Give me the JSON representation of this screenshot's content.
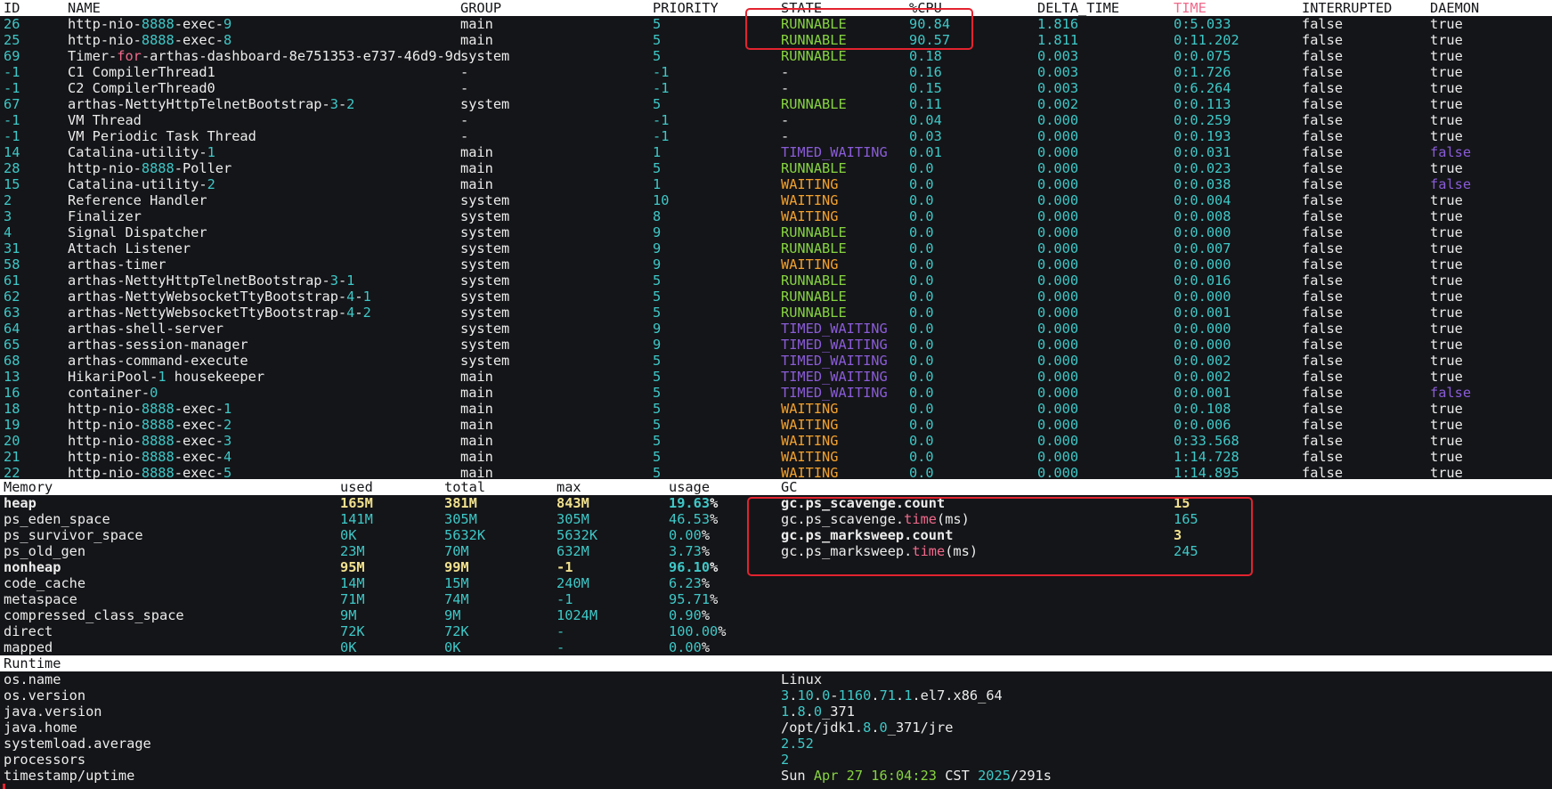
{
  "thread_table": {
    "headers": {
      "id": "ID",
      "name": "NAME",
      "group": "GROUP",
      "priority": "PRIORITY",
      "state": "STATE",
      "cpu": "%CPU",
      "delta": "DELTA_TIME",
      "time": "TIME",
      "interrupted": "INTERRUPTED",
      "daemon": "DAEMON"
    },
    "rows": [
      {
        "id": "26",
        "name": [
          "http-nio-",
          [
            "8888",
            "cyan"
          ],
          "-exec-",
          [
            "9",
            "cyan"
          ]
        ],
        "group": "main",
        "priority": "5",
        "state": "RUNNABLE",
        "cpu": "90.84",
        "delta": "1.816",
        "time": "0:5.033",
        "interrupted": "false",
        "daemon": "true"
      },
      {
        "id": "25",
        "name": [
          "http-nio-",
          [
            "8888",
            "cyan"
          ],
          "-exec-",
          [
            "8",
            "cyan"
          ]
        ],
        "group": "main",
        "priority": "5",
        "state": "RUNNABLE",
        "cpu": "90.57",
        "delta": "1.811",
        "time": "0:11.202",
        "interrupted": "false",
        "daemon": "true"
      },
      {
        "id": "69",
        "name": [
          "Timer-",
          [
            "for",
            "pink"
          ],
          "-arthas-dashboard-8e751353-e737-46d9-9d"
        ],
        "group": "system",
        "priority": "5",
        "state": "RUNNABLE",
        "cpu": "0.18",
        "delta": "0.003",
        "time": "0:0.075",
        "interrupted": "false",
        "daemon": "true"
      },
      {
        "id": "-1",
        "name": [
          "C1 CompilerThread1"
        ],
        "group": "-",
        "priority": "-1",
        "state": "-",
        "cpu": "0.16",
        "delta": "0.003",
        "time": "0:1.726",
        "interrupted": "false",
        "daemon": "true"
      },
      {
        "id": "-1",
        "name": [
          "C2 CompilerThread0"
        ],
        "group": "-",
        "priority": "-1",
        "state": "-",
        "cpu": "0.15",
        "delta": "0.003",
        "time": "0:6.264",
        "interrupted": "false",
        "daemon": "true"
      },
      {
        "id": "67",
        "name": [
          "arthas-NettyHttpTelnetBootstrap-",
          [
            "3",
            "cyan"
          ],
          "-",
          [
            "2",
            "cyan"
          ]
        ],
        "group": "system",
        "priority": "5",
        "state": "RUNNABLE",
        "cpu": "0.11",
        "delta": "0.002",
        "time": "0:0.113",
        "interrupted": "false",
        "daemon": "true"
      },
      {
        "id": "-1",
        "name": [
          "VM Thread"
        ],
        "group": "-",
        "priority": "-1",
        "state": "-",
        "cpu": "0.04",
        "delta": "0.000",
        "time": "0:0.259",
        "interrupted": "false",
        "daemon": "true"
      },
      {
        "id": "-1",
        "name": [
          "VM Periodic Task Thread"
        ],
        "group": "-",
        "priority": "-1",
        "state": "-",
        "cpu": "0.03",
        "delta": "0.000",
        "time": "0:0.193",
        "interrupted": "false",
        "daemon": "true"
      },
      {
        "id": "14",
        "name": [
          "Catalina-utility-",
          [
            "1",
            "cyan"
          ]
        ],
        "group": "main",
        "priority": "1",
        "state": "TIMED_WAITING",
        "cpu": "0.01",
        "delta": "0.000",
        "time": "0:0.031",
        "interrupted": "false",
        "daemon": "false"
      },
      {
        "id": "28",
        "name": [
          "http-nio-",
          [
            "8888",
            "cyan"
          ],
          "-Poller"
        ],
        "group": "main",
        "priority": "5",
        "state": "RUNNABLE",
        "cpu": "0.0",
        "delta": "0.000",
        "time": "0:0.023",
        "interrupted": "false",
        "daemon": "true"
      },
      {
        "id": "15",
        "name": [
          "Catalina-utility-",
          [
            "2",
            "cyan"
          ]
        ],
        "group": "main",
        "priority": "1",
        "state": "WAITING",
        "cpu": "0.0",
        "delta": "0.000",
        "time": "0:0.038",
        "interrupted": "false",
        "daemon": "false"
      },
      {
        "id": "2",
        "name": [
          "Reference Handler"
        ],
        "group": "system",
        "priority": "10",
        "state": "WAITING",
        "cpu": "0.0",
        "delta": "0.000",
        "time": "0:0.004",
        "interrupted": "false",
        "daemon": "true"
      },
      {
        "id": "3",
        "name": [
          "Finalizer"
        ],
        "group": "system",
        "priority": "8",
        "state": "WAITING",
        "cpu": "0.0",
        "delta": "0.000",
        "time": "0:0.008",
        "interrupted": "false",
        "daemon": "true"
      },
      {
        "id": "4",
        "name": [
          "Signal Dispatcher"
        ],
        "group": "system",
        "priority": "9",
        "state": "RUNNABLE",
        "cpu": "0.0",
        "delta": "0.000",
        "time": "0:0.000",
        "interrupted": "false",
        "daemon": "true"
      },
      {
        "id": "31",
        "name": [
          "Attach Listener"
        ],
        "group": "system",
        "priority": "9",
        "state": "RUNNABLE",
        "cpu": "0.0",
        "delta": "0.000",
        "time": "0:0.007",
        "interrupted": "false",
        "daemon": "true"
      },
      {
        "id": "58",
        "name": [
          "arthas-timer"
        ],
        "group": "system",
        "priority": "9",
        "state": "WAITING",
        "cpu": "0.0",
        "delta": "0.000",
        "time": "0:0.000",
        "interrupted": "false",
        "daemon": "true"
      },
      {
        "id": "61",
        "name": [
          "arthas-NettyHttpTelnetBootstrap-",
          [
            "3",
            "cyan"
          ],
          "-",
          [
            "1",
            "cyan"
          ]
        ],
        "group": "system",
        "priority": "5",
        "state": "RUNNABLE",
        "cpu": "0.0",
        "delta": "0.000",
        "time": "0:0.016",
        "interrupted": "false",
        "daemon": "true"
      },
      {
        "id": "62",
        "name": [
          "arthas-NettyWebsocketTtyBootstrap-",
          [
            "4",
            "cyan"
          ],
          "-",
          [
            "1",
            "cyan"
          ]
        ],
        "group": "system",
        "priority": "5",
        "state": "RUNNABLE",
        "cpu": "0.0",
        "delta": "0.000",
        "time": "0:0.000",
        "interrupted": "false",
        "daemon": "true"
      },
      {
        "id": "63",
        "name": [
          "arthas-NettyWebsocketTtyBootstrap-",
          [
            "4",
            "cyan"
          ],
          "-",
          [
            "2",
            "cyan"
          ]
        ],
        "group": "system",
        "priority": "5",
        "state": "RUNNABLE",
        "cpu": "0.0",
        "delta": "0.000",
        "time": "0:0.001",
        "interrupted": "false",
        "daemon": "true"
      },
      {
        "id": "64",
        "name": [
          "arthas-shell-server"
        ],
        "group": "system",
        "priority": "9",
        "state": "TIMED_WAITING",
        "cpu": "0.0",
        "delta": "0.000",
        "time": "0:0.000",
        "interrupted": "false",
        "daemon": "true"
      },
      {
        "id": "65",
        "name": [
          "arthas-session-manager"
        ],
        "group": "system",
        "priority": "9",
        "state": "TIMED_WAITING",
        "cpu": "0.0",
        "delta": "0.000",
        "time": "0:0.000",
        "interrupted": "false",
        "daemon": "true"
      },
      {
        "id": "68",
        "name": [
          "arthas-command-execute"
        ],
        "group": "system",
        "priority": "5",
        "state": "TIMED_WAITING",
        "cpu": "0.0",
        "delta": "0.000",
        "time": "0:0.002",
        "interrupted": "false",
        "daemon": "true"
      },
      {
        "id": "13",
        "name": [
          "HikariPool-",
          [
            "1",
            "cyan"
          ],
          " housekeeper"
        ],
        "group": "main",
        "priority": "5",
        "state": "TIMED_WAITING",
        "cpu": "0.0",
        "delta": "0.000",
        "time": "0:0.002",
        "interrupted": "false",
        "daemon": "true"
      },
      {
        "id": "16",
        "name": [
          "container-",
          [
            "0",
            "cyan"
          ]
        ],
        "group": "main",
        "priority": "5",
        "state": "TIMED_WAITING",
        "cpu": "0.0",
        "delta": "0.000",
        "time": "0:0.001",
        "interrupted": "false",
        "daemon": "false"
      },
      {
        "id": "18",
        "name": [
          "http-nio-",
          [
            "8888",
            "cyan"
          ],
          "-exec-",
          [
            "1",
            "cyan"
          ]
        ],
        "group": "main",
        "priority": "5",
        "state": "WAITING",
        "cpu": "0.0",
        "delta": "0.000",
        "time": "0:0.108",
        "interrupted": "false",
        "daemon": "true"
      },
      {
        "id": "19",
        "name": [
          "http-nio-",
          [
            "8888",
            "cyan"
          ],
          "-exec-",
          [
            "2",
            "cyan"
          ]
        ],
        "group": "main",
        "priority": "5",
        "state": "WAITING",
        "cpu": "0.0",
        "delta": "0.000",
        "time": "0:0.006",
        "interrupted": "false",
        "daemon": "true"
      },
      {
        "id": "20",
        "name": [
          "http-nio-",
          [
            "8888",
            "cyan"
          ],
          "-exec-",
          [
            "3",
            "cyan"
          ]
        ],
        "group": "main",
        "priority": "5",
        "state": "WAITING",
        "cpu": "0.0",
        "delta": "0.000",
        "time": "0:33.568",
        "interrupted": "false",
        "daemon": "true"
      },
      {
        "id": "21",
        "name": [
          "http-nio-",
          [
            "8888",
            "cyan"
          ],
          "-exec-",
          [
            "4",
            "cyan"
          ]
        ],
        "group": "main",
        "priority": "5",
        "state": "WAITING",
        "cpu": "0.0",
        "delta": "0.000",
        "time": "1:14.728",
        "interrupted": "false",
        "daemon": "true"
      },
      {
        "id": "22",
        "name": [
          "http-nio-",
          [
            "8888",
            "cyan"
          ],
          "-exec-",
          [
            "5",
            "cyan"
          ]
        ],
        "group": "main",
        "priority": "5",
        "state": "WAITING",
        "cpu": "0.0",
        "delta": "0.000",
        "time": "1:14.895",
        "interrupted": "false",
        "daemon": "true"
      }
    ]
  },
  "memory": {
    "headers": {
      "name": "Memory",
      "used": "used",
      "total": "total",
      "max": "max",
      "usage": "usage",
      "gc": "GC"
    },
    "rows": [
      {
        "name": "heap",
        "used": "165M",
        "total": "381M",
        "max": "843M",
        "usage": "19.63",
        "bold": true
      },
      {
        "name": "ps_eden_space",
        "used": "141M",
        "total": "305M",
        "max": "305M",
        "usage": "46.53",
        "bold": false
      },
      {
        "name": "ps_survivor_space",
        "used": "0K",
        "total": "5632K",
        "max": "5632K",
        "usage": "0.00",
        "bold": false
      },
      {
        "name": "ps_old_gen",
        "used": "23M",
        "total": "70M",
        "max": "632M",
        "usage": "3.73",
        "bold": false
      },
      {
        "name": "nonheap",
        "used": "95M",
        "total": "99M",
        "max": "-1",
        "usage": "96.10",
        "bold": true
      },
      {
        "name": "code_cache",
        "used": "14M",
        "total": "15M",
        "max": "240M",
        "usage": "6.23",
        "bold": false
      },
      {
        "name": "metaspace",
        "used": "71M",
        "total": "74M",
        "max": "-1",
        "usage": "95.71",
        "bold": false
      },
      {
        "name": "compressed_class_space",
        "used": "9M",
        "total": "9M",
        "max": "1024M",
        "usage": "0.90",
        "bold": false
      },
      {
        "name": "direct",
        "used": "72K",
        "total": "72K",
        "max": "-",
        "usage": "100.00",
        "bold": false
      },
      {
        "name": "mapped",
        "used": "0K",
        "total": "0K",
        "max": "-",
        "usage": "0.00",
        "bold": false
      }
    ],
    "percent_sign": "%"
  },
  "gc": {
    "rows": [
      {
        "name": [
          [
            "gc.ps_scavenge.count",
            "bold"
          ]
        ],
        "value": "15",
        "bold": true
      },
      {
        "name": [
          "gc.ps_scavenge.",
          [
            "time",
            "pink"
          ],
          "(ms)"
        ],
        "value": "165",
        "bold": false
      },
      {
        "name": [
          [
            "gc.ps_marksweep.count",
            "bold"
          ]
        ],
        "value": "3",
        "bold": true
      },
      {
        "name": [
          "gc.ps_marksweep.",
          [
            "time",
            "pink"
          ],
          "(ms)"
        ],
        "value": "245",
        "bold": false
      }
    ]
  },
  "runtime": {
    "header": "Runtime",
    "rows": [
      {
        "key": "os.name",
        "value": [
          "Linux"
        ]
      },
      {
        "key": "os.version",
        "value": [
          [
            "3",
            "cyan"
          ],
          ".",
          [
            "10",
            "cyan"
          ],
          ".",
          [
            "0",
            "cyan"
          ],
          "-",
          [
            "1160",
            "cyan"
          ],
          ".",
          [
            "71",
            "cyan"
          ],
          ".",
          [
            "1",
            "cyan"
          ],
          ".el7.x86_64"
        ]
      },
      {
        "key": "java.version",
        "value": [
          [
            "1",
            "cyan"
          ],
          ".",
          [
            "8",
            "cyan"
          ],
          ".",
          [
            "0",
            "cyan"
          ],
          "_371"
        ]
      },
      {
        "key": "java.home",
        "value": [
          "/opt/jdk1.",
          [
            "8",
            "cyan"
          ],
          ".",
          [
            "0",
            "cyan"
          ],
          "_371/jre"
        ]
      },
      {
        "key": "systemload.average",
        "value": [
          [
            "2.52",
            "cyan"
          ]
        ]
      },
      {
        "key": "processors",
        "value": [
          [
            "2",
            "cyan"
          ]
        ]
      },
      {
        "key": "timestamp/uptime",
        "value": [
          "Sun ",
          [
            "Apr 27 16:04:23",
            "green"
          ],
          " CST ",
          [
            "2025",
            "cyan"
          ],
          "/291s"
        ]
      }
    ]
  },
  "colors": {
    "background": "#141518",
    "header_bg": "#ffffff",
    "text": "#e8e8e8",
    "cyan": "#3ec8c8",
    "runnable": "#86d341",
    "waiting": "#f3a12c",
    "timed_waiting": "#8a5cd8",
    "time_header": "#f06a8c",
    "bold_value": "#f0e08e",
    "highlight_box": "#e3232f"
  }
}
